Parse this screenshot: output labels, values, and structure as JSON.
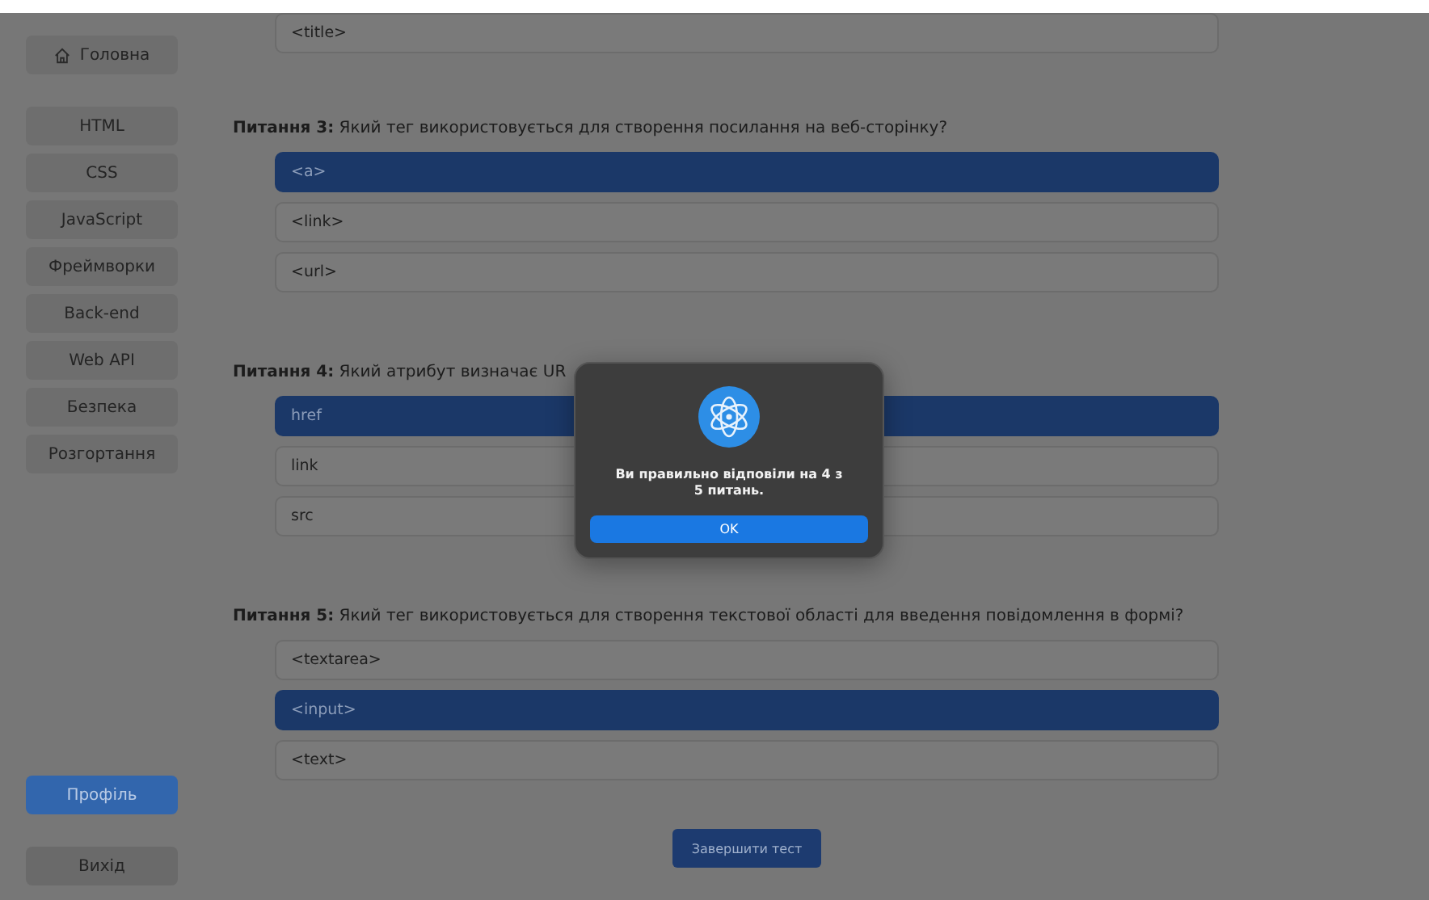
{
  "sidebar": {
    "home": {
      "label": "Головна"
    },
    "items": [
      {
        "label": "HTML"
      },
      {
        "label": "CSS"
      },
      {
        "label": "JavaScript"
      },
      {
        "label": "Фреймворки"
      },
      {
        "label": "Back-end"
      },
      {
        "label": "Web API"
      },
      {
        "label": "Безпека"
      },
      {
        "label": "Розгортання"
      }
    ],
    "profile": {
      "label": "Профіль"
    },
    "logout": {
      "label": "Вихід"
    }
  },
  "questions": [
    {
      "options": [
        {
          "text": "<title>",
          "selected": false
        }
      ]
    },
    {
      "heading": "**Питання 3:** Який тег використовується для створення посилання на веб-сторінку?",
      "options": [
        {
          "text": "<a>",
          "selected": true
        },
        {
          "text": "<link>",
          "selected": false
        },
        {
          "text": "<url>",
          "selected": false
        }
      ]
    },
    {
      "heading": "**Питання 4:** Який атрибут визначає UR",
      "options": [
        {
          "text": "href",
          "selected": true
        },
        {
          "text": "link",
          "selected": false
        },
        {
          "text": "src",
          "selected": false
        }
      ]
    },
    {
      "heading": "**Питання 5:** Який тег використовується для створення текстової області для введення повідомлення в формі?",
      "options": [
        {
          "text": "<textarea>",
          "selected": false
        },
        {
          "text": "<input>",
          "selected": true
        },
        {
          "text": "<text>",
          "selected": false
        }
      ]
    }
  ],
  "finish_button": "Завершити тест",
  "dialog": {
    "message": "Ви правильно відповіли на 4 з\n5 питань.",
    "button": "OK"
  }
}
